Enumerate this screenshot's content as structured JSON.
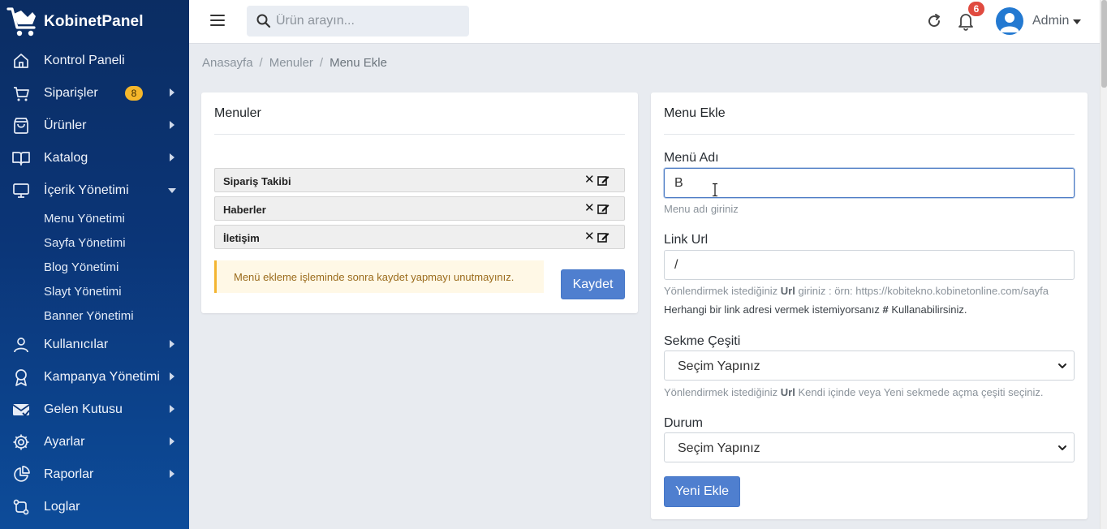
{
  "brand": {
    "name": "KobinetPanel"
  },
  "sidebar": {
    "items": [
      {
        "label": "Kontrol Paneli",
        "icon": "home-icon"
      },
      {
        "label": "Siparişler",
        "icon": "cart-icon",
        "badge": "8"
      },
      {
        "label": "Ürünler",
        "icon": "bag-icon"
      },
      {
        "label": "Katalog",
        "icon": "book-icon"
      },
      {
        "label": "İçerik Yönetimi",
        "icon": "monitor-icon"
      },
      {
        "label": "Kullanıcılar",
        "icon": "user-icon"
      },
      {
        "label": "Kampanya Yönetimi",
        "icon": "award-icon"
      },
      {
        "label": "Gelen Kutusu",
        "icon": "mail-check-icon"
      },
      {
        "label": "Ayarlar",
        "icon": "gear-icon"
      },
      {
        "label": "Raporlar",
        "icon": "pie-chart-icon"
      },
      {
        "label": "Loglar",
        "icon": "git-compare-icon"
      }
    ],
    "subitems": [
      "Menu Yönetimi",
      "Sayfa Yönetimi",
      "Blog Yönetimi",
      "Slayt Yönetimi",
      "Banner Yönetimi"
    ]
  },
  "topbar": {
    "search_placeholder": "Ürün arayın...",
    "notification_count": "6",
    "user_name": "Admin"
  },
  "breadcrumb": [
    "Anasayfa",
    "Menuler",
    "Menu Ekle"
  ],
  "menus_card": {
    "title": "Menuler",
    "items": [
      "Sipariş Takibi",
      "Haberler",
      "İletişim"
    ],
    "delete_glyph": "✕",
    "alert": "Menü ekleme işleminde sonra kaydet yapmayı unutmayınız.",
    "save_label": "Kaydet"
  },
  "form_card": {
    "title": "Menu Ekle",
    "name_label": "Menü Adı",
    "name_value": "B",
    "name_hint": "Menu adı giriniz",
    "url_label": "Link Url",
    "url_value": "/",
    "url_hint_pre": "Yönlendirmek istediğiniz ",
    "url_hint_bold": "Url",
    "url_hint_post": " giriniz : örn: https://kobitekno.kobinetonline.com/sayfa",
    "url_note_pre": "Herhangi bir link adresi vermek istemiyorsanız ",
    "url_note_bold": "#",
    "url_note_post": " Kullanabilirsiniz.",
    "tab_label": "Sekme Çeşiti",
    "tab_value": "Seçim Yapınız",
    "tab_hint_pre": "Yönlendirmek istediğiniz ",
    "tab_hint_bold": "Url",
    "tab_hint_post": " Kendi içinde veya Yeni sekmede açma çeşiti seçiniz.",
    "status_label": "Durum",
    "status_value": "Seçim Yapınız",
    "add_label": "Yeni Ekle"
  },
  "colors": {
    "sidebar_top": "#0b2d63",
    "sidebar_bottom": "#0d4c9a",
    "primary": "#4f7fcf",
    "badge_yellow": "#f5b72b",
    "badge_red": "#e04a3f"
  }
}
